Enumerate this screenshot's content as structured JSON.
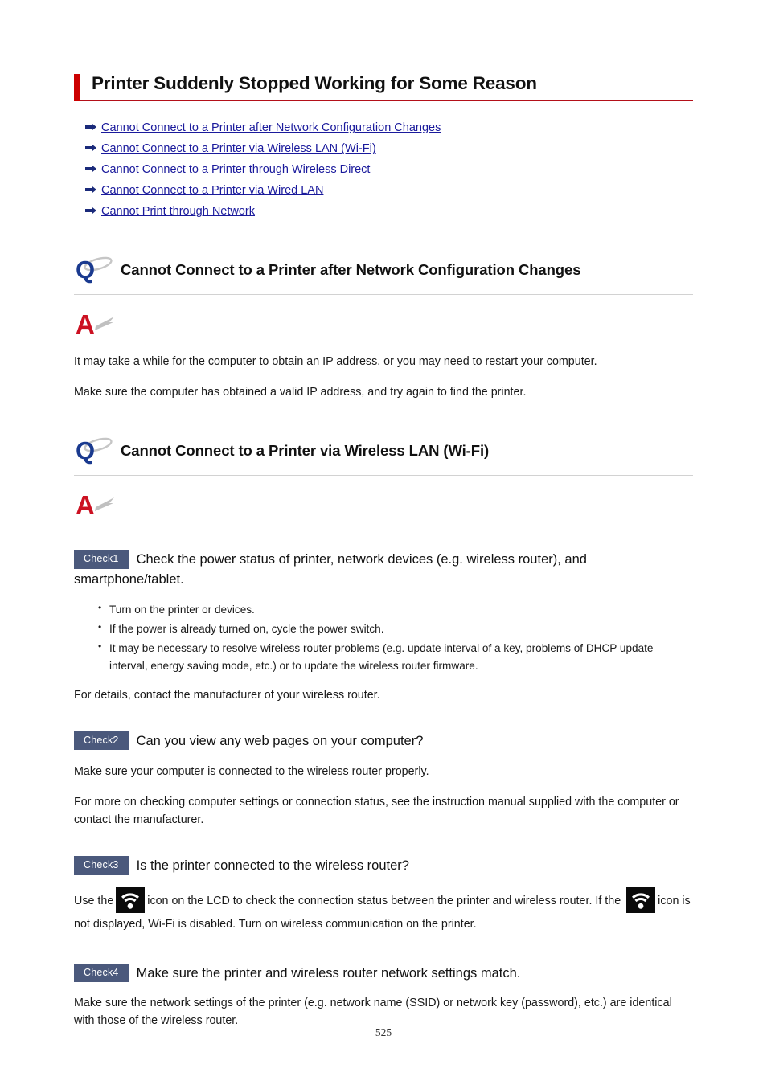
{
  "document": {
    "title": "Printer Suddenly Stopped Working for Some Reason",
    "page_number": "525"
  },
  "colors": {
    "title_accent_bar": "#cc0000",
    "title_rule": "#b41019",
    "link": "#1a1a9c",
    "check_badge_bg": "#4b597c",
    "q_icon": "#1a3a8f",
    "a_icon": "#cc1122",
    "swoosh": "#b8b8b8",
    "section_rule": "#d2d2d2",
    "lcd_icon_bg": "#0b0b0b"
  },
  "toc": {
    "bullet_icon": "arrow-right-icon",
    "links": [
      {
        "label": "Cannot Connect to a Printer after Network Configuration Changes"
      },
      {
        "label": "Cannot Connect to a Printer via Wireless LAN (Wi-Fi)"
      },
      {
        "label": "Cannot Connect to a Printer through Wireless Direct"
      },
      {
        "label": "Cannot Connect to a Printer via Wired LAN"
      },
      {
        "label": "Cannot Print through Network"
      }
    ]
  },
  "sections": [
    {
      "q_icon": "question-q-icon",
      "a_icon": "answer-a-icon",
      "heading": "Cannot Connect to a Printer after Network Configuration Changes",
      "paragraphs": [
        "It may take a while for the computer to obtain an IP address, or you may need to restart your computer.",
        "Make sure the computer has obtained a valid IP address, and try again to find the printer."
      ]
    },
    {
      "q_icon": "question-q-icon",
      "a_icon": "answer-a-icon",
      "heading": "Cannot Connect to a Printer via Wireless LAN (Wi-Fi)"
    }
  ],
  "checks": [
    {
      "badge": "Check1",
      "title": "Check the power status of printer, network devices (e.g. wireless router), and smartphone/tablet.",
      "bullets": [
        "Turn on the printer or devices.",
        "If the power is already turned on, cycle the power switch.",
        "It may be necessary to resolve wireless router problems (e.g. update interval of a key, problems of DHCP update interval, energy saving mode, etc.) or to update the wireless router firmware."
      ],
      "footer": "For details, contact the manufacturer of your wireless router."
    },
    {
      "badge": "Check2",
      "title": "Can you view any web pages on your computer?",
      "paragraphs": [
        "Make sure your computer is connected to the wireless router properly.",
        "For more on checking computer settings or connection status, see the instruction manual supplied with the computer or contact the manufacturer."
      ]
    },
    {
      "badge": "Check3",
      "title": "Is the printer connected to the wireless router?",
      "inline": {
        "icon_name": "wifi-lcd-icon",
        "text_before": "Use the",
        "text_middle": "icon on the LCD to check the connection status between the printer and wireless router. If the",
        "text_after": "icon is not displayed, Wi-Fi is disabled. Turn on wireless communication on the printer."
      }
    },
    {
      "badge": "Check4",
      "title": "Make sure the printer and wireless router network settings match.",
      "paragraphs": [
        "Make sure the network settings of the printer (e.g. network name (SSID) or network key (password), etc.) are identical with those of the wireless router."
      ]
    }
  ]
}
